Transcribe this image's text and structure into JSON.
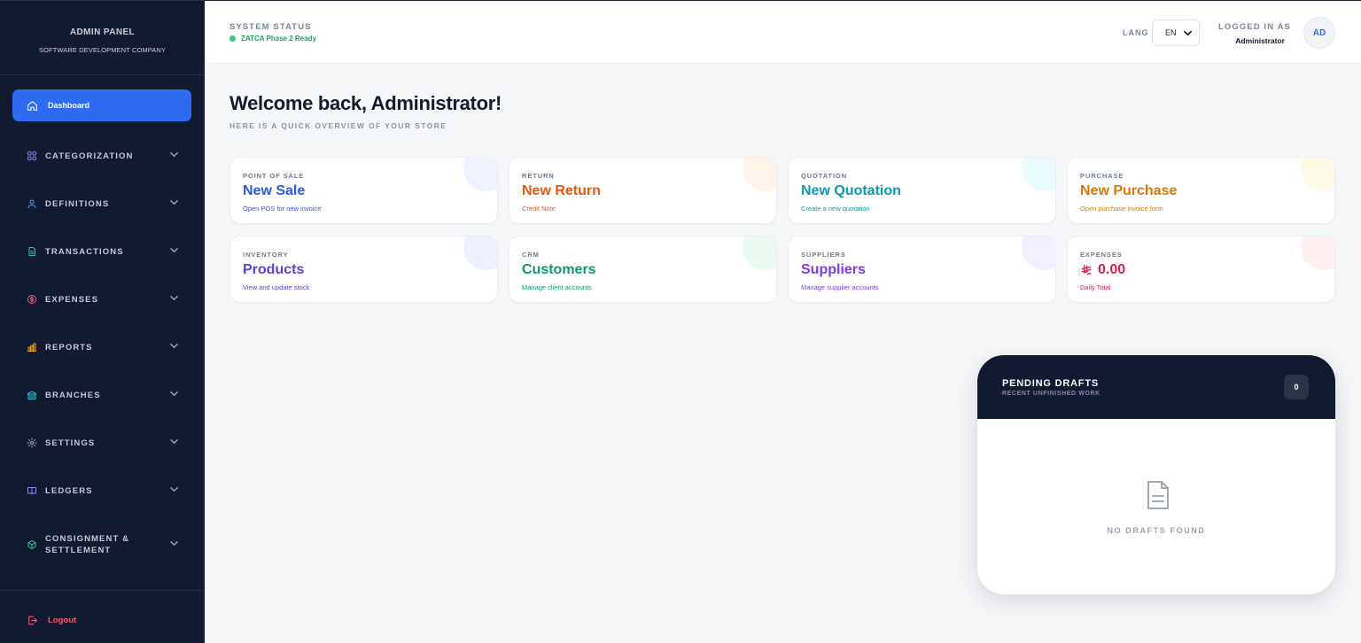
{
  "sidebar": {
    "title": "ADMIN PANEL",
    "subtitle": "SOFTWARE DEVELOPMENT COMPANY",
    "dashboard_label": "Dashboard",
    "items": [
      {
        "label": "CATEGORIZATION",
        "icon": "grid-icon",
        "color": "#8b7cf6"
      },
      {
        "label": "DEFINITIONS",
        "icon": "user-icon",
        "color": "#4ea1f7"
      },
      {
        "label": "TRANSACTIONS",
        "icon": "document-icon",
        "color": "#2ecc9a"
      },
      {
        "label": "EXPENSES",
        "icon": "dollar-icon",
        "color": "#f25c7a"
      },
      {
        "label": "REPORTS",
        "icon": "bar-chart-icon",
        "color": "#f5a524"
      },
      {
        "label": "BRANCHES",
        "icon": "bank-icon",
        "color": "#35c6e0"
      },
      {
        "label": "SETTINGS",
        "icon": "gear-icon",
        "color": "#a9b1bf"
      },
      {
        "label": "LEDGERS",
        "icon": "book-icon",
        "color": "#7c8cf8"
      },
      {
        "label": "CONSIGNMENT & SETTLEMENT",
        "icon": "package-icon",
        "color": "#2ecc9a"
      }
    ],
    "logout_label": "Logout"
  },
  "topbar": {
    "system_status_label": "SYSTEM STATUS",
    "system_status_value": "ZATCA Phase 2 Ready",
    "lang_label": "LANG",
    "lang_value": "EN",
    "logged_in_label": "LOGGED IN AS",
    "logged_in_user": "Administrator",
    "avatar_initials": "AD"
  },
  "main": {
    "welcome": "Welcome back, Administrator!",
    "overview": "HERE IS A QUICK OVERVIEW OF YOUR STORE",
    "cards": [
      {
        "label": "POINT OF SALE",
        "title": "New Sale",
        "sub": "Open POS for new invoice",
        "color": "#2a5ae8",
        "bubble": "#eef3ff"
      },
      {
        "label": "RETURN",
        "title": "New Return",
        "sub": "Credit Note",
        "color": "#ea580c",
        "bubble": "#fff3ea"
      },
      {
        "label": "QUOTATION",
        "title": "New Quotation",
        "sub": "Create a new quotation",
        "color": "#0e98b5",
        "bubble": "#eafcfd"
      },
      {
        "label": "PURCHASE",
        "title": "New Purchase",
        "sub": "Open purchase invoice form",
        "color": "#d97706",
        "bubble": "#fff9e8"
      },
      {
        "label": "INVENTORY",
        "title": "Products",
        "sub": "View and update stock",
        "color": "#5b3ee0",
        "bubble": "#eef0ff"
      },
      {
        "label": "CRM",
        "title": "Customers",
        "sub": "Manage client accounts",
        "color": "#0f9a63",
        "bubble": "#eafaf1"
      },
      {
        "label": "SUPPLIERS",
        "title": "Suppliers",
        "sub": "Manage supplier accounts",
        "color": "#7c3aed",
        "bubble": "#f3efff"
      },
      {
        "label": "EXPENSES",
        "title": "0.00",
        "sub": "Daily Total",
        "color": "#e11d48",
        "bubble": "#fff0f2",
        "currency_icon": "riyal-icon"
      }
    ]
  },
  "drafts": {
    "title": "PENDING DRAFTS",
    "subtitle": "RECENT UNFINISHED WORK",
    "count": "0",
    "empty_message": "NO DRAFTS FOUND"
  }
}
